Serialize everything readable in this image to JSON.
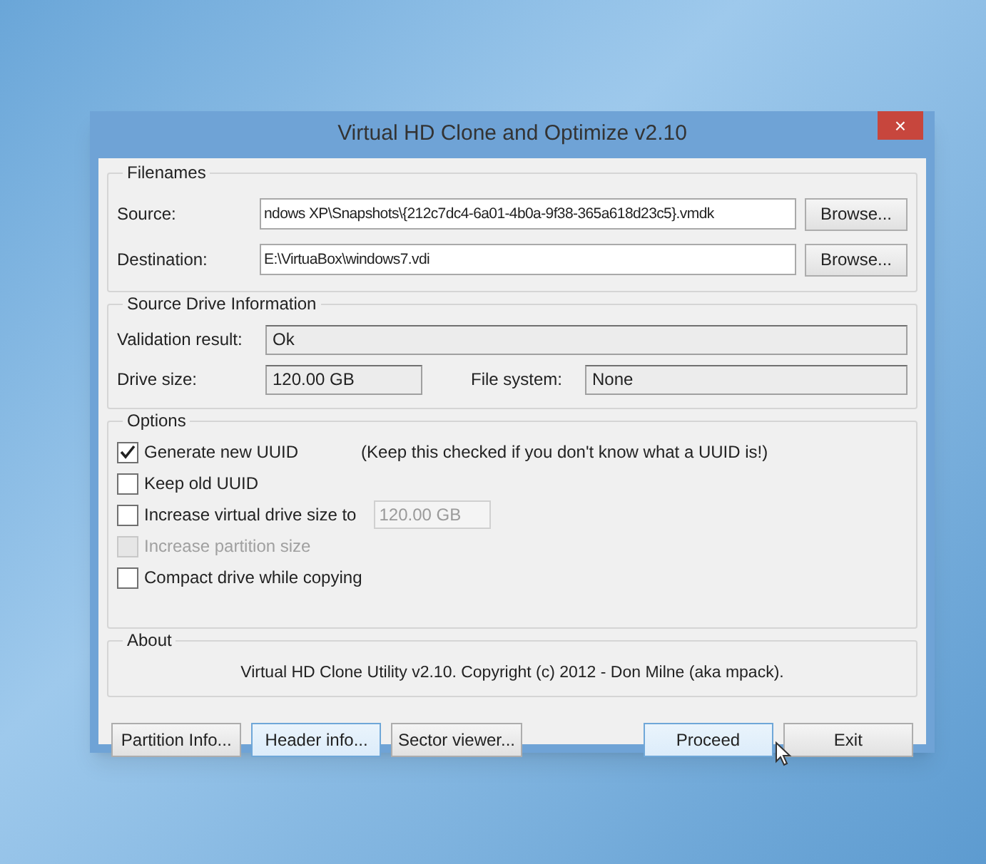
{
  "window": {
    "title": "Virtual HD Clone and Optimize v2.10",
    "close": "×"
  },
  "filenames": {
    "title": "Filenames",
    "rows": [
      {
        "label": "Source:",
        "value": "ndows XP\\Snapshots\\{212c7dc4-6a01-4b0a-9f38-365a618d23c5}.vmdk",
        "button": "Browse..."
      },
      {
        "label": "Destination:",
        "value": "E:\\VirtuaBox\\windows7.vdi",
        "button": "Browse..."
      }
    ]
  },
  "drive_info": {
    "title": "Source Drive Information",
    "validation_label": "Validation result:",
    "validation_value": "Ok",
    "drive_size_label": "Drive size:",
    "drive_size_value": "120.00 GB",
    "file_system_label": "File system:",
    "file_system_value": "None"
  },
  "options": {
    "title": "Options",
    "items": [
      {
        "label": "Generate new UUID",
        "checked": true,
        "disabled": false,
        "note": "(Keep this checked if you don't know what a UUID is!)"
      },
      {
        "label": "Keep old UUID",
        "checked": false,
        "disabled": false
      },
      {
        "label": "Increase virtual drive size to",
        "checked": false,
        "disabled": false,
        "size_value": "120.00 GB"
      },
      {
        "label": "Increase partition size",
        "checked": false,
        "disabled": true
      },
      {
        "label": "Compact drive while copying",
        "checked": false,
        "disabled": false
      }
    ]
  },
  "about": {
    "title": "About",
    "text": "Virtual HD Clone Utility v2.10. Copyright (c) 2012 - Don Milne (aka mpack)."
  },
  "buttons": [
    {
      "label": "Partition Info...",
      "highlighted": false,
      "spacer_before": false
    },
    {
      "label": "Header info...",
      "highlighted": true,
      "spacer_before": false
    },
    {
      "label": "Sector viewer...",
      "highlighted": false,
      "spacer_before": false
    },
    {
      "label": "Proceed",
      "highlighted": true,
      "spacer_before": true
    },
    {
      "label": "Exit",
      "highlighted": false,
      "spacer_before": false
    }
  ]
}
